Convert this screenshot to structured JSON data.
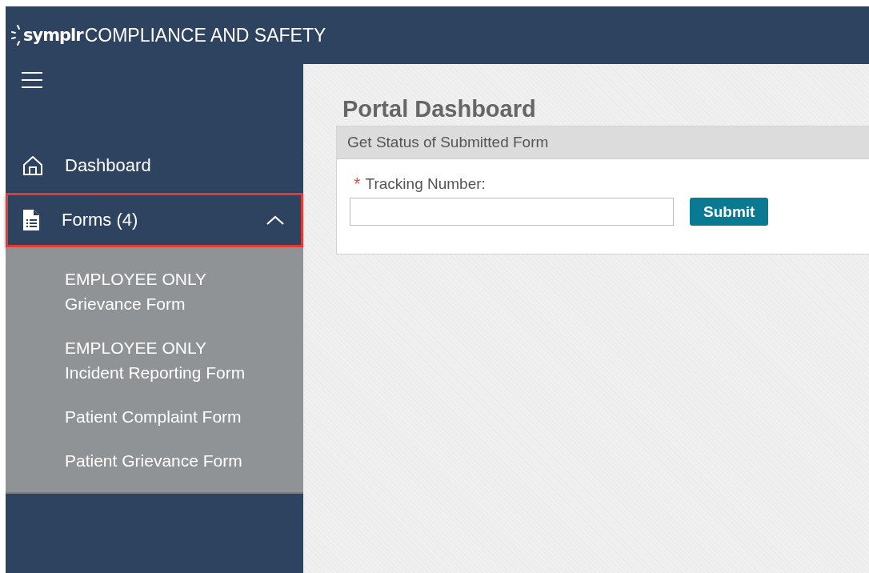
{
  "header": {
    "brand": "symplr",
    "product": "COMPLIANCE AND SAFETY"
  },
  "sidebar": {
    "items": [
      {
        "kind": "link",
        "label": "Dashboard"
      },
      {
        "kind": "group",
        "label": "Forms (4)",
        "expanded": true,
        "highlighted": true,
        "children": [
          {
            "label": "EMPLOYEE ONLY Grievance Form"
          },
          {
            "label": "EMPLOYEE ONLY Incident Reporting Form"
          },
          {
            "label": "Patient Complaint Form"
          },
          {
            "label": "Patient Grievance Form"
          }
        ]
      }
    ]
  },
  "main": {
    "title": "Portal Dashboard",
    "panel": {
      "title": "Get Status of Submitted Form",
      "field": {
        "required_mark": "*",
        "label": "Tracking Number:"
      },
      "button": "Submit"
    }
  }
}
